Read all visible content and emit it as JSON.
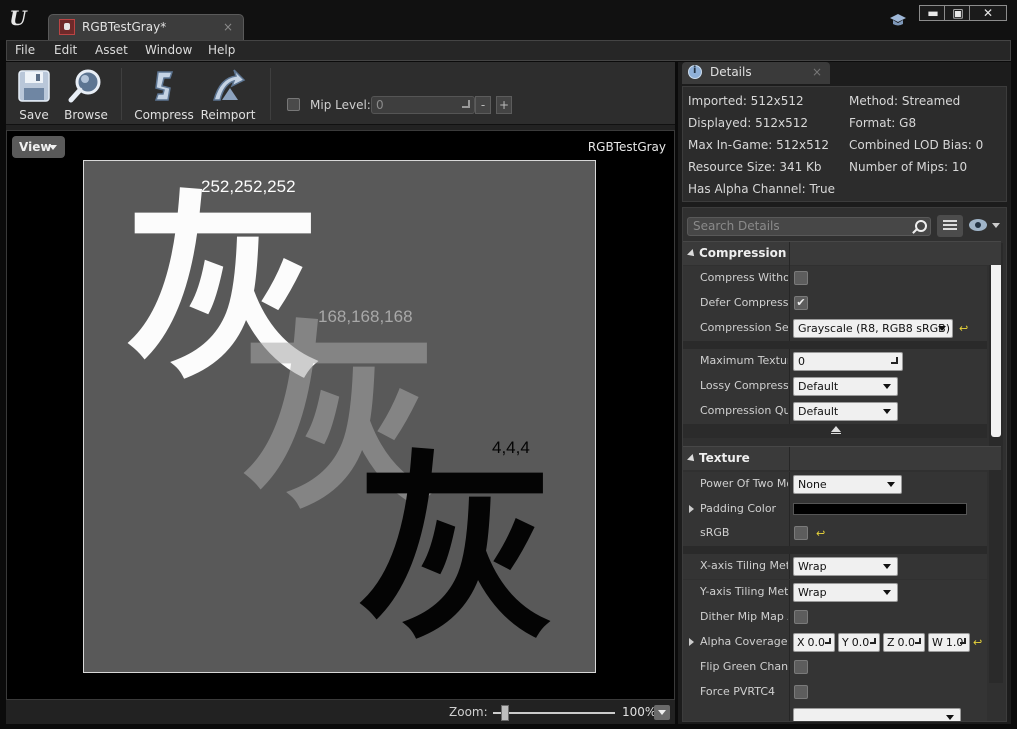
{
  "window": {
    "tab_title": "RGBTestGray*",
    "tab_close": "×",
    "min_glyph": "▬",
    "max_glyph": "▣",
    "close_glyph": "✕",
    "logo_text": "U"
  },
  "menu": [
    "File",
    "Edit",
    "Asset",
    "Window",
    "Help"
  ],
  "toolbar": {
    "save": "Save",
    "browse": "Browse",
    "compress": "Compress",
    "reimport": "Reimport",
    "mip_label": "Mip Level:",
    "mip_value": "0",
    "mip_minus": "-",
    "mip_plus": "+"
  },
  "viewport": {
    "view_button": "View",
    "asset_name": "RGBTestGray",
    "glyph": "灰",
    "samples": [
      {
        "label": "252,252,252",
        "color": "#fcfcfc"
      },
      {
        "label": "168,168,168",
        "color": "#a8a8a8"
      },
      {
        "label": "4,4,4",
        "color": "#040404"
      }
    ],
    "background_color": "#595959"
  },
  "zoom": {
    "label": "Zoom:",
    "value": "100%",
    "level": 0.1
  },
  "details": {
    "tab_label": "Details",
    "tab_close": "×",
    "info": {
      "imported": "Imported: 512x512",
      "method": "Method: Streamed",
      "displayed": "Displayed: 512x512",
      "format": "Format: G8",
      "max_ingame": "Max In-Game: 512x512",
      "lod_bias": "Combined LOD Bias: 0",
      "resource_size": "Resource Size: 341 Kb",
      "num_mips": "Number of Mips: 10",
      "has_alpha": "Has Alpha Channel: True"
    },
    "search_placeholder": "Search Details",
    "compression": {
      "title": "Compression",
      "compress_without_alpha": "Compress Without Alpha",
      "defer_compression": "Defer Compression",
      "compression_settings": "Compression Settings",
      "compression_settings_value": "Grayscale (R8, RGB8 sRGB)",
      "max_texture_size": "Maximum Texture Size",
      "max_texture_size_value": "0",
      "lossy_compression": "Lossy Compression Amount",
      "lossy_value": "Default",
      "compression_quality": "Compression Quality",
      "quality_value": "Default"
    },
    "texture": {
      "title": "Texture",
      "power_of_two": "Power Of Two Mode",
      "power_of_two_value": "None",
      "padding_color": "Padding Color",
      "srgb": "sRGB",
      "x_tiling": "X-axis Tiling Method",
      "x_tiling_value": "Wrap",
      "y_tiling": "Y-axis Tiling Method",
      "y_tiling_value": "Wrap",
      "dither_mip": "Dither Mip Map Alpha",
      "alpha_coverage": "Alpha Coverage Thresholds",
      "alpha_x": "X",
      "alpha_x_val": "0.0",
      "alpha_y": "Y",
      "alpha_y_val": "0.0",
      "alpha_z": "Z",
      "alpha_z_val": "0.0",
      "alpha_w": "W",
      "alpha_w_val": "1.0",
      "flip_green": "Flip Green Channel",
      "force_pvrtc4": "Force PVRTC4"
    },
    "checkmark": "✔",
    "reset_glyph": "↩"
  }
}
